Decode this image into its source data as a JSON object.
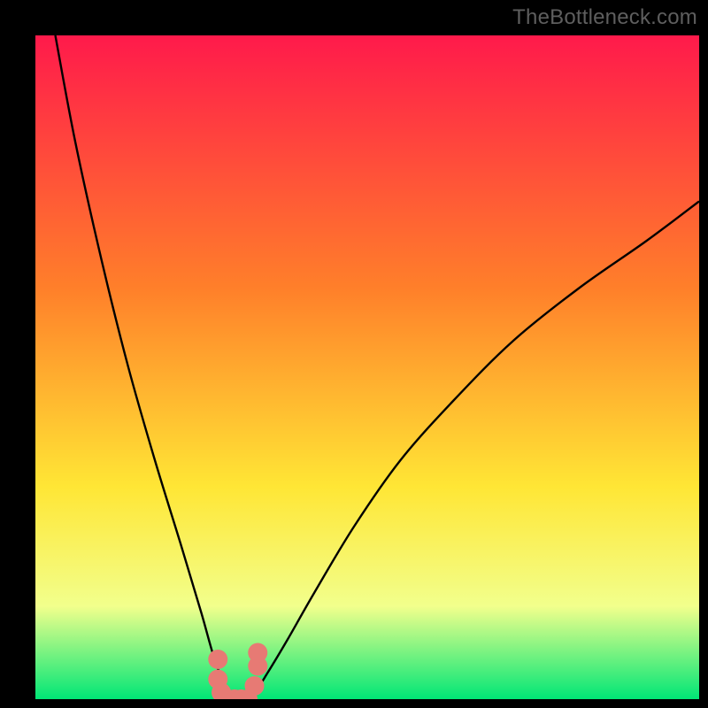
{
  "watermark": "TheBottleneck.com",
  "chart_data": {
    "type": "line",
    "title": "",
    "xlabel": "",
    "ylabel": "",
    "xlim": [
      0,
      100
    ],
    "ylim": [
      0,
      100
    ],
    "grid": false,
    "legend": false,
    "background_gradient": {
      "top": "#ff1a4b",
      "mid1": "#ff7f2a",
      "mid2": "#ffe635",
      "mid3": "#f2ff8c",
      "bottom": "#00e676"
    },
    "curve_note": "V-shaped bottleneck curve; minimum near x≈30 (y≈0). Left branch rises to ~100 at x≈3; right branch rises to ~75 at x≈100.",
    "series": [
      {
        "name": "bottleneck-curve",
        "color": "#000000",
        "x": [
          3,
          6,
          10,
          14,
          18,
          22,
          25,
          27,
          29,
          30,
          31,
          33,
          35,
          38,
          42,
          48,
          55,
          63,
          72,
          82,
          92,
          100
        ],
        "y": [
          100,
          84,
          66,
          50,
          36,
          23,
          13,
          6,
          1,
          0,
          0,
          1,
          4,
          9,
          16,
          26,
          36,
          45,
          54,
          62,
          69,
          75
        ]
      }
    ],
    "markers": {
      "name": "highlight-dots",
      "color": "#e77a74",
      "points": [
        {
          "x": 27.5,
          "y": 6
        },
        {
          "x": 27.5,
          "y": 3
        },
        {
          "x": 28.0,
          "y": 1
        },
        {
          "x": 29.0,
          "y": 0
        },
        {
          "x": 30.0,
          "y": 0
        },
        {
          "x": 31.0,
          "y": 0
        },
        {
          "x": 32.0,
          "y": 0
        },
        {
          "x": 33.0,
          "y": 2
        },
        {
          "x": 33.5,
          "y": 5
        },
        {
          "x": 33.5,
          "y": 7
        }
      ]
    }
  }
}
